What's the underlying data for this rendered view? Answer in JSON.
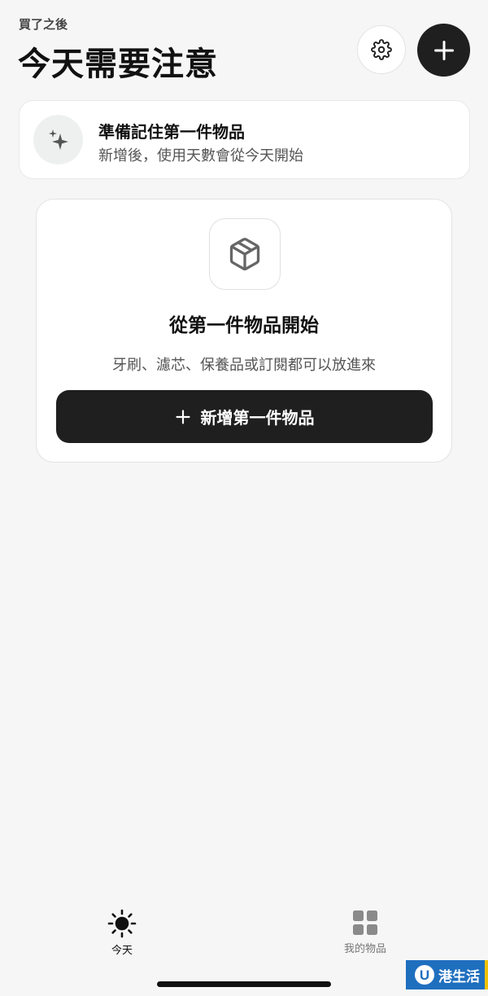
{
  "header": {
    "app_subtitle": "買了之後",
    "title": "今天需要注意"
  },
  "hint_card": {
    "title": "準備記住第一件物品",
    "description": "新增後，使用天數會從今天開始"
  },
  "empty_state": {
    "title": "從第一件物品開始",
    "description": "牙刷、濾芯、保養品或訂閱都可以放進來",
    "button_label": "新增第一件物品"
  },
  "tabs": [
    {
      "label": "今天",
      "icon": "sun-icon",
      "active": true
    },
    {
      "label": "我的物品",
      "icon": "grid-icon",
      "active": false
    }
  ],
  "watermark": {
    "logo_letter": "U",
    "text": "港生活"
  },
  "colors": {
    "background": "#f6f6f6",
    "primary": "#1f1f1f",
    "watermark_blue": "#1f6fbf",
    "watermark_accent": "#f2c200"
  }
}
